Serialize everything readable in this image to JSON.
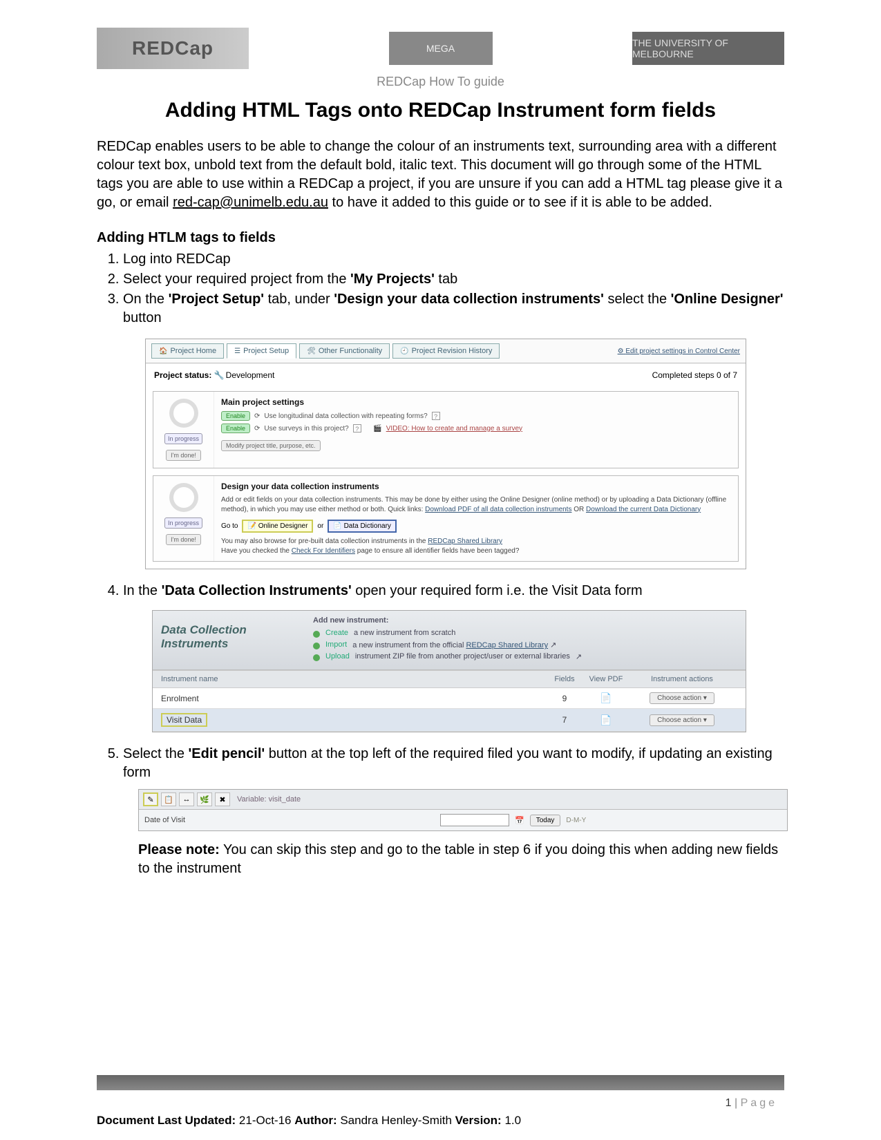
{
  "header": {
    "logo1": "REDCap",
    "logo2": "MEGA",
    "logo3": "THE UNIVERSITY OF MELBOURNE",
    "guide_label": "REDCap How To guide"
  },
  "title": "Adding HTML Tags onto REDCap Instrument form fields",
  "intro_text": "REDCap enables users to be able to change the colour of an instruments text, surrounding area with a different colour text box, unbold text from the default bold, italic text. This document will go through some of the HTML tags you are able to use within a REDCap a project, if you are unsure if you can add a HTML tag please give it a go, or email ",
  "intro_email": "red-cap@unimelb.edu.au",
  "intro_text_tail": " to have it added to this guide or to see if it is able to be added.",
  "section_heading": "Adding HTLM tags to fields",
  "steps": {
    "s1": "Log into REDCap",
    "s2_a": "Select your required project from the ",
    "s2_b": "'My Projects'",
    "s2_c": " tab",
    "s3_a": "On the ",
    "s3_b": "'Project Setup'",
    "s3_c": " tab, under ",
    "s3_d": "'Design your data collection instruments'",
    "s3_e": " select the ",
    "s3_f": "'Online Designer'",
    "s3_g": " button",
    "s4_a": "In the ",
    "s4_b": "'Data Collection Instruments'",
    "s4_c": " open your required form i.e. the Visit Data form",
    "s5_a": "Select the ",
    "s5_b": "'Edit pencil'",
    "s5_c": " button at the top left of the required filed you want to modify, if updating an existing form"
  },
  "shot1": {
    "tabs": {
      "home": "Project Home",
      "setup": "Project Setup",
      "other": "Other Functionality",
      "history": "Project Revision History"
    },
    "edit_link": "Edit project settings in Control Center",
    "status_label": "Project status:",
    "status_value": "Development",
    "completed": "Completed steps 0 of 7",
    "panel1_title": "Main project settings",
    "np_label": "In progress",
    "done_btn": "I'm done!",
    "enable": "Enable",
    "longitudinal": "Use longitudinal data collection with repeating forms?",
    "surveys": "Use surveys in this project?",
    "video": "VIDEO: How to create and manage a survey",
    "modify_btn": "Modify project title, purpose, etc.",
    "panel2_title": "Design your data collection instruments",
    "panel2_text1": "Add or edit fields on your data collection instruments. This may be done by either using the Online Designer (online method) or by uploading a Data Dictionary (offline method), in which you may use either method or both. Quick links: ",
    "panel2_link1": "Download PDF of all data collection instruments",
    "panel2_mid": " OR ",
    "panel2_link2": "Download the current Data Dictionary",
    "goto": "Go to",
    "od_btn": "Online Designer",
    "or": "or",
    "dd_btn": "Data Dictionary",
    "panel2_text2a": "You may also browse for pre-built data collection instruments in the ",
    "panel2_link3": "REDCap Shared Library",
    "panel2_text3a": "Have you checked the ",
    "panel2_link4": "Check For Identifiers",
    "panel2_text3b": " page to ensure all identifier fields have been tagged?"
  },
  "shot2": {
    "heading": "Data Collection Instruments",
    "add_heading": "Add new instrument:",
    "create_label": "Create",
    "create_text": "a new instrument from scratch",
    "import_label": "Import",
    "import_text_a": "a new instrument from the official ",
    "import_link": "REDCap Shared Library",
    "upload_label": "Upload",
    "upload_text": "instrument ZIP file from another project/user or external libraries",
    "col_name": "Instrument name",
    "col_fields": "Fields",
    "col_pdf": "View PDF",
    "col_actions": "Instrument actions",
    "row1_name": "Enrolment",
    "row1_fields": "9",
    "row2_name": "Visit Data",
    "row2_fields": "7",
    "choose_action": "Choose action"
  },
  "shot3": {
    "var": "Variable: visit_date",
    "label": "Date of Visit",
    "today": "Today",
    "hint": "D-M-Y"
  },
  "note_label": "Please note:",
  "note_text": "  You can skip this step and go to the table in step 6 if you doing this when adding new fields to the instrument",
  "footer": {
    "page_num": "1",
    "page_word": "Page",
    "updated_label": "Document Last Updated:",
    "updated_val": " 21-Oct-16 ",
    "author_label": "Author:",
    "author_val": " Sandra Henley-Smith ",
    "version_label": "Version:",
    "version_val": " 1.0"
  }
}
